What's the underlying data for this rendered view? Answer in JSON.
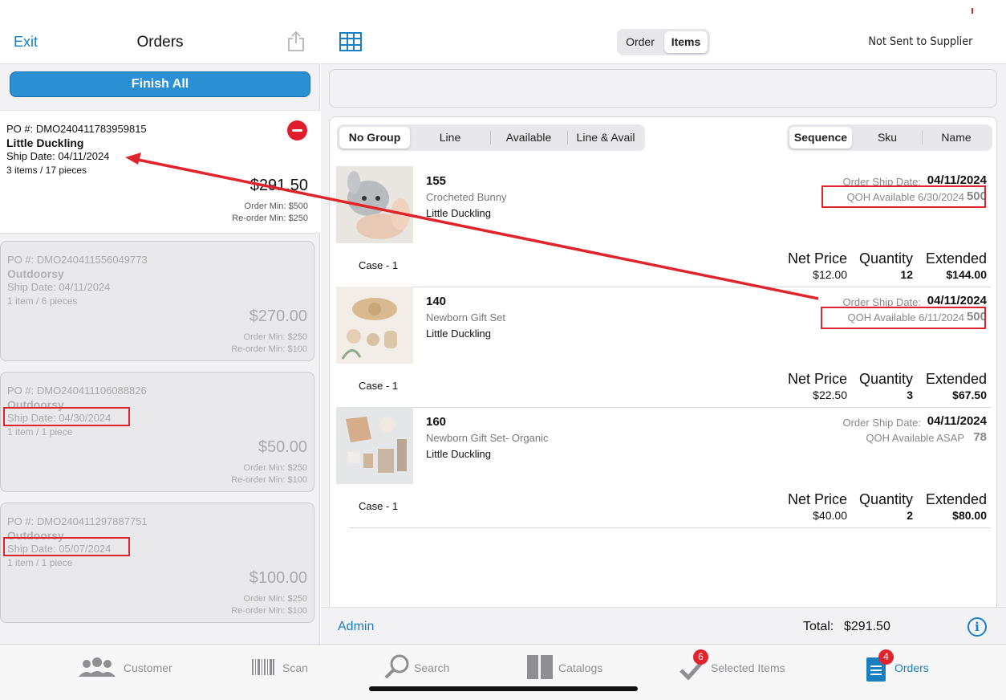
{
  "left": {
    "exit_label": "Exit",
    "title": "Orders",
    "finish_all_label": "Finish All",
    "orders": [
      {
        "po": "PO #: DMO240411783959815",
        "name": "Little Duckling",
        "ship_date": "Ship Date: 04/11/2024",
        "items": "3 items / 17 pieces",
        "total": "$291.50",
        "order_min": "Order Min: $500",
        "reorder_min": "Re-order Min: $250"
      },
      {
        "po": "PO #: DMO240411556049773",
        "name": "Outdoorsy",
        "ship_date": "Ship Date: 04/11/2024",
        "items": "1 item / 6 pieces",
        "total": "$270.00",
        "order_min": "Order Min: $250",
        "reorder_min": "Re-order Min: $100"
      },
      {
        "po": "PO #: DMO240411106088826",
        "name": "Outdoorsy",
        "ship_date": "Ship Date: 04/30/2024",
        "items": "1 item / 1 piece",
        "total": "$50.00",
        "order_min": "Order Min: $250",
        "reorder_min": "Re-order Min: $100"
      },
      {
        "po": "PO #: DMO240411297887751",
        "name": "Outdoorsy",
        "ship_date": "Ship Date: 05/07/2024",
        "items": "1 item / 1 piece",
        "total": "$100.00",
        "order_min": "Order Min: $250",
        "reorder_min": "Re-order Min: $100"
      }
    ]
  },
  "right": {
    "view_tabs": [
      "Order",
      "Items"
    ],
    "status": "Not Sent to Supplier",
    "group_tabs": [
      "No Group",
      "Line",
      "Available",
      "Line & Avail"
    ],
    "sort_tabs": [
      "Sequence",
      "Sku",
      "Name"
    ],
    "col_net_price": "Net Price",
    "col_quantity": "Quantity",
    "col_extended": "Extended",
    "ship_label": "Order Ship Date:",
    "items": [
      {
        "num": "155",
        "desc": "Crocheted Bunny",
        "vendor": "Little Duckling",
        "ship_date": "04/11/2024",
        "qoh_label": "QOH Available 6/30/2024",
        "qoh_value": "500",
        "case": "Case - 1",
        "net_price": "$12.00",
        "quantity": "12",
        "extended": "$144.00"
      },
      {
        "num": "140",
        "desc": "Newborn Gift Set",
        "vendor": "Little Duckling",
        "ship_date": "04/11/2024",
        "qoh_label": "QOH Available 6/11/2024",
        "qoh_value": "500",
        "case": "Case - 1",
        "net_price": "$22.50",
        "quantity": "3",
        "extended": "$67.50"
      },
      {
        "num": "160",
        "desc": "Newborn Gift Set- Organic",
        "vendor": "Little Duckling",
        "ship_date": "04/11/2024",
        "qoh_label": "QOH Available ASAP",
        "qoh_value": "78",
        "case": "Case - 1",
        "net_price": "$40.00",
        "quantity": "2",
        "extended": "$80.00"
      }
    ],
    "footer": {
      "admin_label": "Admin",
      "total_label": "Total:",
      "total_value": "$291.50",
      "info_glyph": "i"
    }
  },
  "tabbar": {
    "customer": "Customer",
    "scan": "Scan",
    "search": "Search",
    "catalogs": "Catalogs",
    "selected_items": "Selected Items",
    "selected_badge": "6",
    "orders": "Orders",
    "orders_badge": "4"
  },
  "colors": {
    "accent": "#1a7fc1",
    "finish_button": "#2a8fd3",
    "badge": "#e0242c",
    "annotation": "#e0242c"
  }
}
